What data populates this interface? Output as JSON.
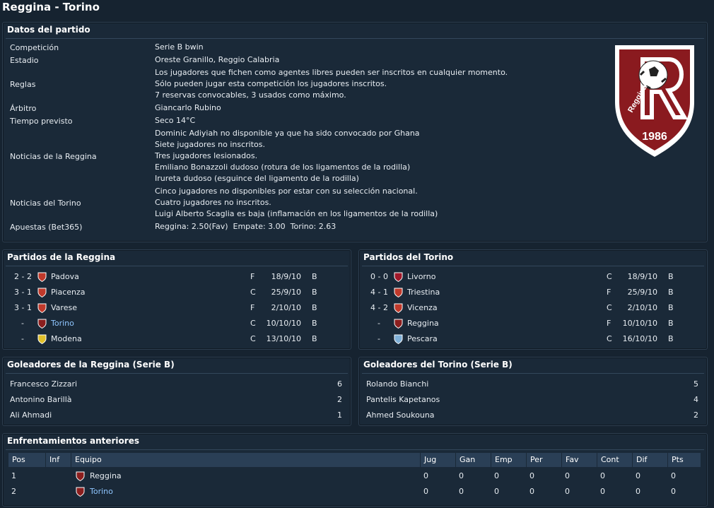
{
  "title": "Reggina - Torino",
  "details": {
    "header": "Datos del partido",
    "competition_label": "Competición",
    "competition": "Serie B bwin",
    "stadium_label": "Estadio",
    "stadium": "Oreste Granillo, Reggio Calabria",
    "rules_label": "Reglas",
    "rules": [
      "Los jugadores que fichen como agentes libres pueden ser inscritos en cualquier momento.",
      "Sólo pueden jugar esta competición los jugadores inscritos.",
      "7 reservas convocables, 3 usados como máximo."
    ],
    "referee_label": "Árbitro",
    "referee": "Giancarlo Rubino",
    "weather_label": "Tiempo previsto",
    "weather": "Seco 14°C",
    "home_news_label": "Noticias de la Reggina",
    "home_news": [
      "Dominic Adiyiah no disponible ya que ha sido convocado por Ghana",
      "Siete jugadores no inscritos.",
      "Tres jugadores lesionados.",
      "Emiliano Bonazzoli dudoso (rotura de los ligamentos de la rodilla)",
      "Irureta dudoso (esguince del ligamento de la rodilla)"
    ],
    "away_news_label": "Noticias del Torino",
    "away_news": [
      "Cinco jugadores no disponibles por estar con su selección nacional.",
      "Cuatro jugadores no inscritos.",
      "Luigi Alberto Scaglia es baja (inflamación en los ligamentos de la rodilla)"
    ],
    "odds_label": "Apuestas (Bet365)",
    "odds": "Reggina: 2.50(Fav)  Empate: 3.00  Torino: 2.63",
    "logo_year": "1986",
    "logo_text": "Reggina"
  },
  "home_fixtures": {
    "header": "Partidos de la Reggina",
    "rows": [
      {
        "score": "2 - 2",
        "team": "Padova",
        "venue": "F",
        "date": "18/9/10",
        "comp": "B",
        "color": "#c0392b"
      },
      {
        "score": "3 - 1",
        "team": "Piacenza",
        "venue": "C",
        "date": "25/9/10",
        "comp": "B",
        "color": "#c0392b"
      },
      {
        "score": "3 - 1",
        "team": "Varese",
        "venue": "F",
        "date": "2/10/10",
        "comp": "B",
        "color": "#c0392b"
      },
      {
        "score": "-",
        "team": "Torino",
        "venue": "C",
        "date": "10/10/10",
        "comp": "B",
        "color": "#8b1e1e",
        "link": true
      },
      {
        "score": "-",
        "team": "Modena",
        "venue": "C",
        "date": "13/10/10",
        "comp": "B",
        "color": "#e1c02a"
      }
    ]
  },
  "away_fixtures": {
    "header": "Partidos del Torino",
    "rows": [
      {
        "score": "0 - 0",
        "team": "Livorno",
        "venue": "C",
        "date": "18/9/10",
        "comp": "B",
        "color": "#a0182a"
      },
      {
        "score": "4 - 1",
        "team": "Triestina",
        "venue": "F",
        "date": "25/9/10",
        "comp": "B",
        "color": "#c0392b"
      },
      {
        "score": "4 - 2",
        "team": "Vicenza",
        "venue": "C",
        "date": "2/10/10",
        "comp": "B",
        "color": "#c0392b"
      },
      {
        "score": "-",
        "team": "Reggina",
        "venue": "F",
        "date": "10/10/10",
        "comp": "B",
        "color": "#8b1e1e"
      },
      {
        "score": "-",
        "team": "Pescara",
        "venue": "C",
        "date": "16/10/10",
        "comp": "B",
        "color": "#7fb0d8"
      }
    ]
  },
  "home_scorers": {
    "header": "Goleadores de la Reggina (Serie B)",
    "rows": [
      {
        "name": "Francesco Zizzari",
        "goals": "6"
      },
      {
        "name": "Antonino Barillà",
        "goals": "2"
      },
      {
        "name": "Ali Ahmadi",
        "goals": "1"
      }
    ]
  },
  "away_scorers": {
    "header": "Goleadores del Torino (Serie B)",
    "rows": [
      {
        "name": "Rolando Bianchi",
        "goals": "5"
      },
      {
        "name": "Pantelis Kapetanos",
        "goals": "4"
      },
      {
        "name": "Ahmed Soukouna",
        "goals": "2"
      }
    ]
  },
  "h2h": {
    "header": "Enfrentamientos anteriores",
    "columns": [
      "Pos",
      "Inf",
      "Equipo",
      "Jug",
      "Gan",
      "Emp",
      "Per",
      "Fav",
      "Cont",
      "Dif",
      "Pts"
    ],
    "rows": [
      {
        "pos": "1",
        "team": "Reggina",
        "vals": [
          "0",
          "0",
          "0",
          "0",
          "0",
          "0",
          "0",
          "0"
        ],
        "color": "#8b1e1e"
      },
      {
        "pos": "2",
        "team": "Torino",
        "vals": [
          "0",
          "0",
          "0",
          "0",
          "0",
          "0",
          "0",
          "0"
        ],
        "color": "#8b1e1e",
        "link": true
      }
    ]
  }
}
